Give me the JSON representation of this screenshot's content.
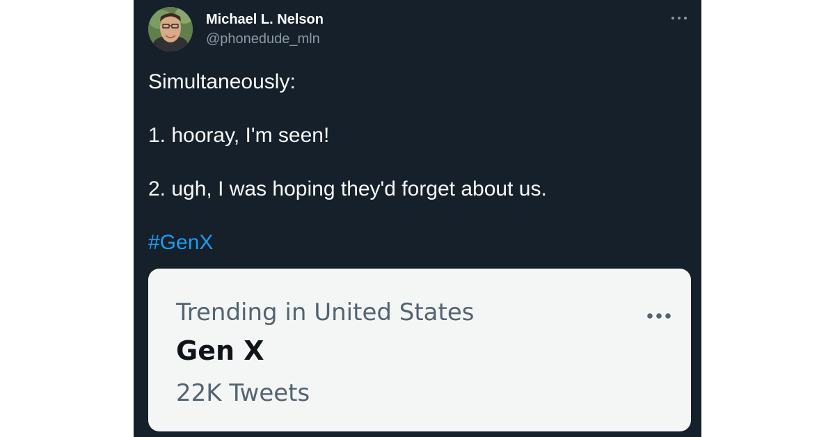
{
  "tweet": {
    "author_name": "Michael L. Nelson",
    "author_handle": "@phonedude_mln",
    "more_icon": "more-horizontal-icon",
    "text_lines": [
      "Simultaneously:",
      "1. hooray, I'm seen!",
      "2.  ugh, I was hoping they'd forget about us."
    ],
    "hashtag": "#GenX"
  },
  "trend_card": {
    "label": "Trending in United States",
    "title": "Gen X",
    "count": "22K Tweets",
    "more_icon": "more-horizontal-icon"
  },
  "colors": {
    "background": "#15202b",
    "text": "#f7f9f9",
    "secondary_text": "#8b98a5",
    "link": "#1d9bf0",
    "card_background": "#f4f6f6"
  }
}
